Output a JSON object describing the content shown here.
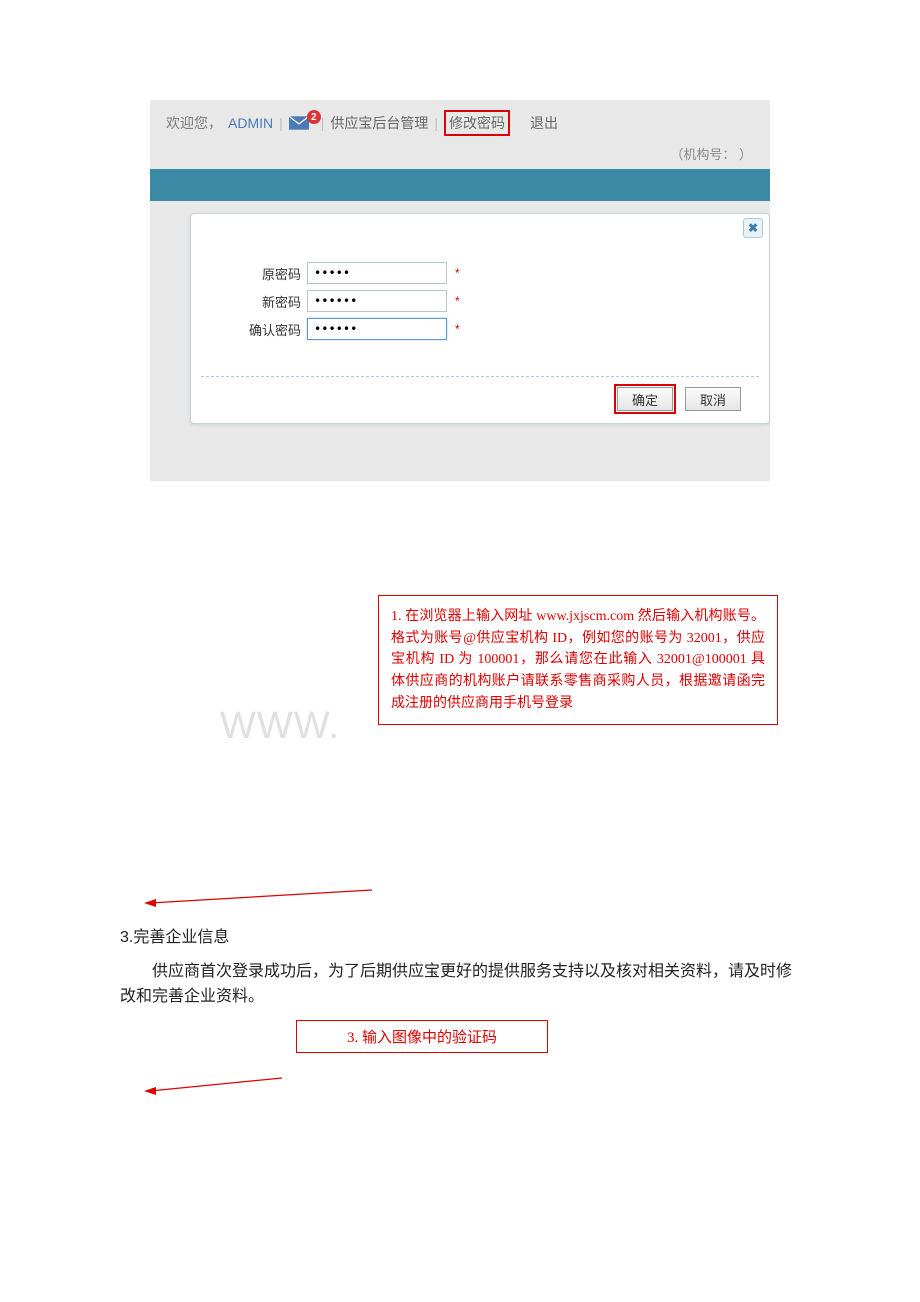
{
  "header": {
    "welcome": "欢迎您，",
    "user": "ADMIN",
    "badge_count": "2",
    "nav_admin": "供应宝后台管理",
    "nav_change_pwd": "修改密码",
    "nav_logout": "退出",
    "org_label": "（机构号：             ）"
  },
  "dialog": {
    "close_glyph": "✖",
    "fields": {
      "old_label": "原密码",
      "old_value": "•••••",
      "new_label": "新密码",
      "new_value": "••••••",
      "confirm_label": "确认密码",
      "confirm_value": "••••••"
    },
    "star": "*",
    "ok": "确定",
    "cancel": "取消"
  },
  "watermark": "WWW.",
  "anno1": "    1. 在浏览器上输入网址  www.jxjscm.com 然后输入机构账号。格式为账号@供应宝机构 ID，例如您的账号为 32001，供应宝机构 ID 为 100001，那么请您在此输入 32001@100001   具体供应商的机构账户请联系零售商采购人员，根据邀请函完成注册的供应商用手机号登录",
  "doc": {
    "heading": "3.完善企业信息",
    "para": "供应商首次登录成功后，为了后期供应宝更好的提供服务支持以及核对相关资料，请及时修改和完善企业资料。"
  },
  "anno2": "3. 输入图像中的验证码"
}
